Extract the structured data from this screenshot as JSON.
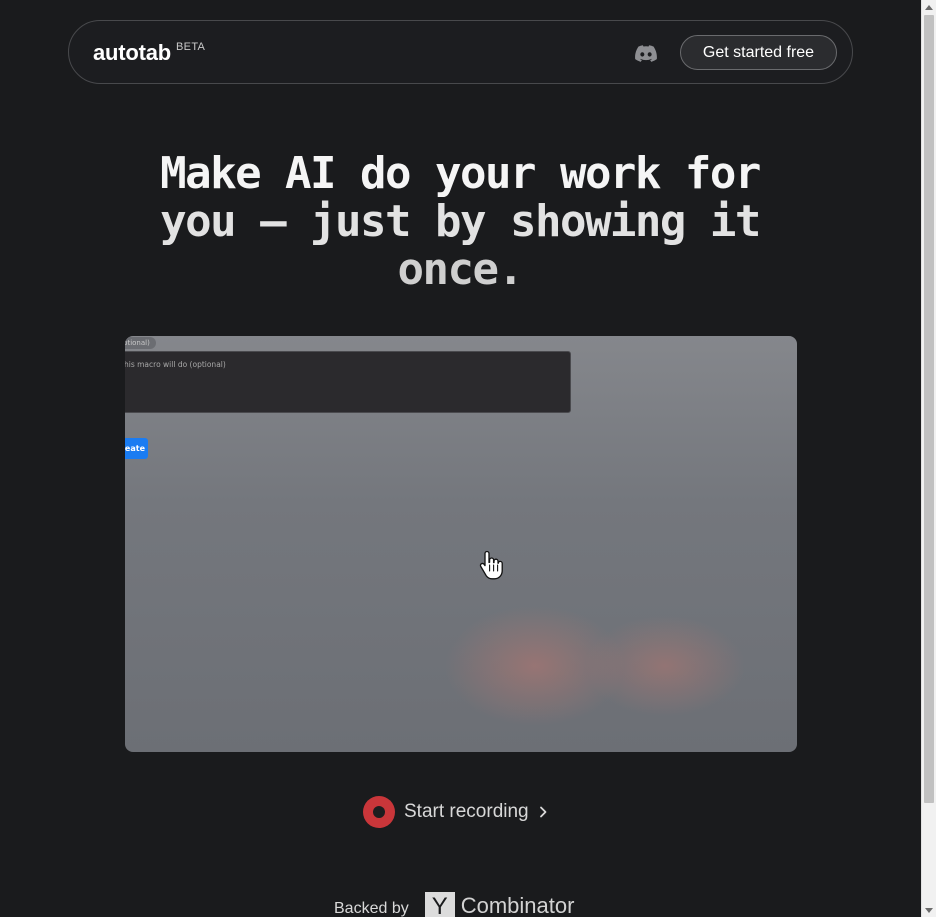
{
  "nav": {
    "brand": "autotab",
    "badge": "BETA",
    "discord_icon": "discord-icon",
    "cta_label": "Get started free"
  },
  "hero": {
    "line1": "Make AI do your work for",
    "line2": "you – just by showing it",
    "line3": "once."
  },
  "video": {
    "tag": "ptional)",
    "placeholder": "his macro will do (optional)",
    "button_label": "eate",
    "cursor_icon": "hand-pointer-icon"
  },
  "recording": {
    "label": "Start recording",
    "icon": "record-icon"
  },
  "backed": {
    "label": "Backed by",
    "logo_letter": "Y",
    "logo_text": "Combinator"
  },
  "colors": {
    "background": "#1a1b1d",
    "record": "#c9363a",
    "accent_button": "#1a7cf2"
  }
}
